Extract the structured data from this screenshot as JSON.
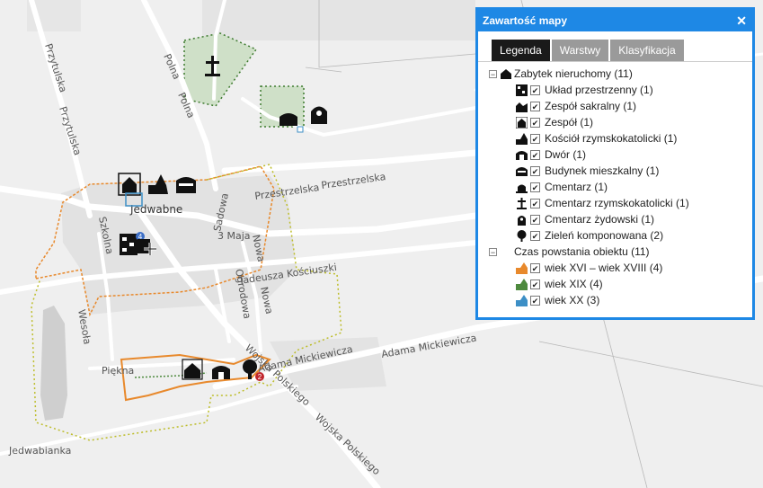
{
  "map": {
    "streets": [
      {
        "name": "przytulska",
        "text": "Przytulska"
      },
      {
        "name": "przytulska-2",
        "text": "Przytulska"
      },
      {
        "name": "polna",
        "text": "Polna"
      },
      {
        "name": "polna-2",
        "text": "Polna"
      },
      {
        "name": "przestrzelska",
        "text": "Przestrzelska"
      },
      {
        "name": "przestrzelska-2",
        "text": "Przestrzelska"
      },
      {
        "name": "szkolna",
        "text": "Szkolna"
      },
      {
        "name": "3-maja",
        "text": "3 Maja"
      },
      {
        "name": "nowa",
        "text": "Nowa"
      },
      {
        "name": "nowa-2",
        "text": "Nowa"
      },
      {
        "name": "sadowa",
        "text": "Sadowa"
      },
      {
        "name": "tadeusza",
        "text": "Tadeusza Kościuszki"
      },
      {
        "name": "ogrodowa",
        "text": "Ogrodowa"
      },
      {
        "name": "wesola",
        "text": "Wesoła"
      },
      {
        "name": "piekna",
        "text": "Piękna"
      },
      {
        "name": "mickiewicza",
        "text": "Adama Mickiewicza"
      },
      {
        "name": "mickiewicza-2",
        "text": "Adama Mickiewicza"
      },
      {
        "name": "wojska",
        "text": "Wojska Polskiego"
      },
      {
        "name": "wojska-2",
        "text": "Wojska Polskiego"
      },
      {
        "name": "jedwabianka",
        "text": "Jedwabianka"
      }
    ],
    "town_label": "Jedwabne",
    "cluster_badges": [
      "4",
      "2"
    ]
  },
  "panel": {
    "title": "Zawartość mapy",
    "close_symbol": "✕",
    "tabs": [
      "Legenda",
      "Warstwy",
      "Klasyfikacja"
    ],
    "active_tab": "Legenda",
    "groups": [
      {
        "label": "Zabytek nieruchomy (11)",
        "expanded_symbol": "−",
        "items": [
          {
            "label": "Układ przestrzenny (1)",
            "icon": "spatial-layout-icon"
          },
          {
            "label": "Zespół sakralny (1)",
            "icon": "sacral-complex-icon"
          },
          {
            "label": "Zespół (1)",
            "icon": "complex-icon"
          },
          {
            "label": "Kościół rzymskokatolicki (1)",
            "icon": "church-icon"
          },
          {
            "label": "Dwór (1)",
            "icon": "manor-icon"
          },
          {
            "label": "Budynek mieszkalny (1)",
            "icon": "house-icon"
          },
          {
            "label": "Cmentarz (1)",
            "icon": "cemetery-icon"
          },
          {
            "label": "Cmentarz rzymskokatolicki (1)",
            "icon": "catholic-cemetery-icon"
          },
          {
            "label": "Cmentarz żydowski (1)",
            "icon": "jewish-cemetery-icon"
          },
          {
            "label": "Zieleń komponowana (2)",
            "icon": "tree-icon"
          }
        ]
      },
      {
        "label": "Czas powstania obiektu (11)",
        "expanded_symbol": "−",
        "items": [
          {
            "label": "wiek XVI – wiek XVIII (4)",
            "icon": "orange-house-icon",
            "color": "#e8892c"
          },
          {
            "label": "wiek XIX (4)",
            "icon": "green-house-icon",
            "color": "#4e8a3e"
          },
          {
            "label": "wiek XX (3)",
            "icon": "blue-house-icon",
            "color": "#3d8fc6"
          }
        ]
      }
    ],
    "check_symbol": "✔"
  },
  "colors": {
    "accent": "#1e88e5",
    "xvi_xviii": "#e8892c",
    "xix": "#4e8a3e",
    "xx": "#3d8fc6"
  }
}
